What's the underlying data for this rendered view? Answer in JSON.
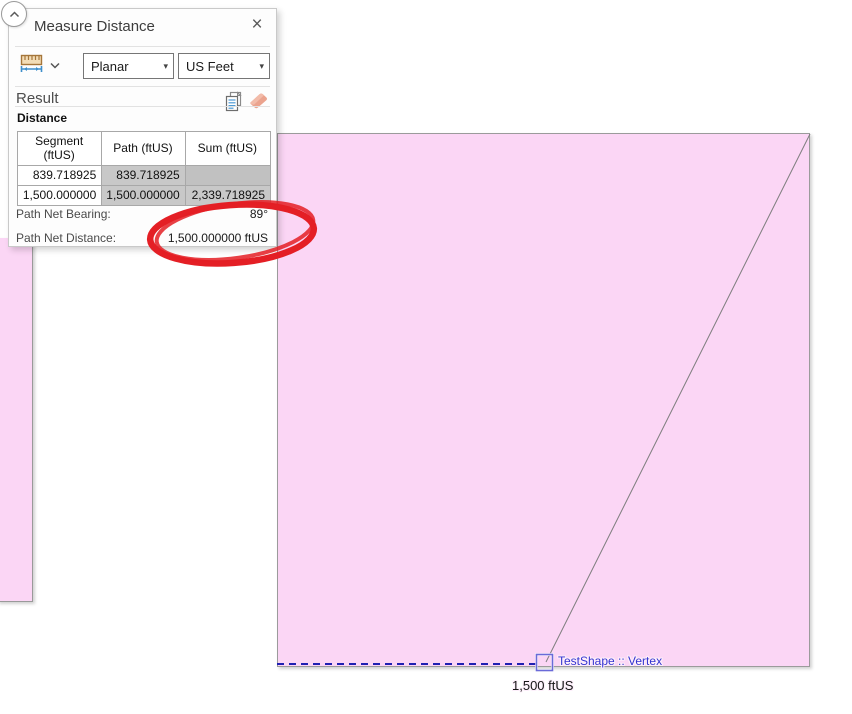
{
  "panel": {
    "title": "Measure Distance",
    "close_label": "×",
    "mode_dropdown": {
      "selected": "Planar"
    },
    "unit_dropdown": {
      "selected": "US Feet"
    },
    "result_label": "Result",
    "distance_label": "Distance",
    "table": {
      "headers": [
        "Segment (ftUS)",
        "Path (ftUS)",
        "Sum (ftUS)"
      ],
      "rows": [
        [
          "839.718925",
          "839.718925",
          ""
        ],
        [
          "1,500.000000",
          "1,500.000000",
          "2,339.718925"
        ]
      ]
    },
    "path_net_bearing_label": "Path Net Bearing:",
    "path_net_bearing_value": "89°",
    "path_net_distance_label": "Path Net Distance:",
    "path_net_distance_value": "1,500.000000 ftUS"
  },
  "map": {
    "snap_tooltip": "TestShape :: Vertex",
    "segment_label": "1,500 ftUS"
  },
  "colors": {
    "polygon_fill": "#fbd6f5",
    "polygon_border": "#9b9b9b",
    "sketch_dashed_line": "#2020b2",
    "measure_line": "#7d7d7d",
    "snap_text": "#3434d0",
    "annotation_red": "#e41f25",
    "table_locked_cell": "#c8c8c8"
  }
}
